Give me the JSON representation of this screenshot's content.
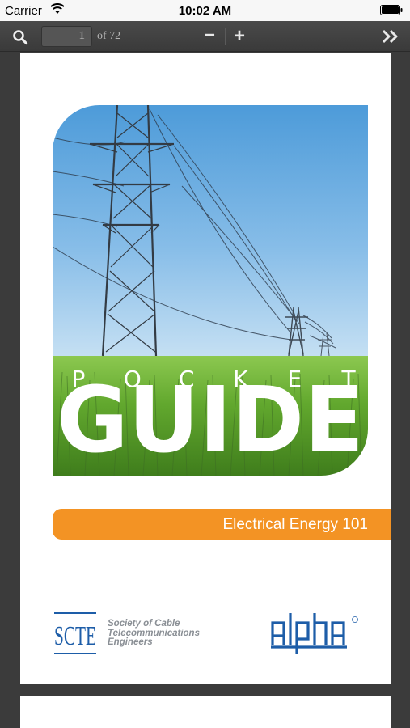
{
  "status_bar": {
    "carrier": "Carrier",
    "time": "10:02 AM"
  },
  "toolbar": {
    "current_page": "1",
    "page_count_label": "of 72",
    "zoom_out_label": "−",
    "zoom_in_label": "+"
  },
  "cover": {
    "pocket_letters": [
      "P",
      "O",
      "C",
      "K",
      "E",
      "T"
    ],
    "guide_title": "GUIDE",
    "subtitle": "Electrical Energy 101",
    "scte_org_lines": [
      "Society of Cable",
      "Telecommunications",
      "Engineers"
    ],
    "scte_logo_text": "SCTE",
    "alpha_logo_text": "alpha"
  },
  "colors": {
    "accent_orange": "#f39324",
    "logo_blue": "#1d5da8",
    "toolbar": "#444444"
  }
}
